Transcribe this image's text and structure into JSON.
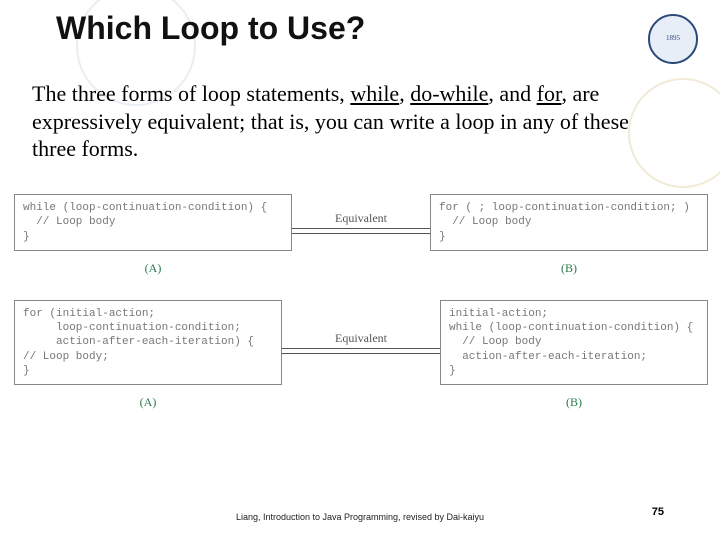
{
  "title": "Which Loop to Use?",
  "intro": {
    "pre": "The three forms of loop statements, ",
    "u1": "while",
    "s1": ", ",
    "u2": "do-while",
    "s2": ", and ",
    "u3": "for",
    "post": ", are expressively equivalent; that is, you can write a loop in any of these three forms."
  },
  "diagrams": {
    "equivalent_label": "Equivalent",
    "label_A": "(A)",
    "label_B": "(B)",
    "row1": {
      "left": "while (loop-continuation-condition) {\n  // Loop body\n}",
      "right": "for ( ; loop-continuation-condition; )\n  // Loop body\n}"
    },
    "row2": {
      "left": "for (initial-action;\n     loop-continuation-condition;\n     action-after-each-iteration) {\n// Loop body;\n}",
      "right": "initial-action;\nwhile (loop-continuation-condition) {\n  // Loop body\n  action-after-each-iteration;\n}"
    }
  },
  "footer": {
    "credit": "Liang, Introduction to Java Programming, revised by Dai-kaiyu",
    "page": "75"
  },
  "logo_text": "1895"
}
